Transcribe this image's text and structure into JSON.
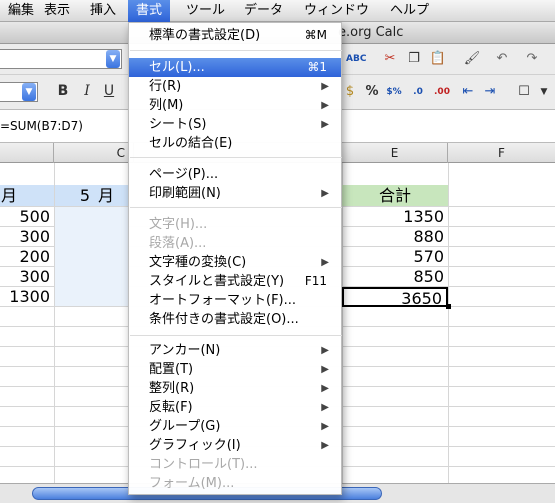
{
  "menubar": {
    "items": [
      {
        "label": "編集"
      },
      {
        "label": "表示"
      },
      {
        "label": "挿入"
      },
      {
        "label": "書式"
      },
      {
        "label": "ツール"
      },
      {
        "label": "データ"
      },
      {
        "label": "ウィンドウ"
      },
      {
        "label": "ヘルプ"
      }
    ]
  },
  "window": {
    "title": "e.org Calc"
  },
  "formula": {
    "text": "=SUM(B7:D7)"
  },
  "columns": {
    "c": "C",
    "e": "E",
    "f": "F"
  },
  "sheet": {
    "header_left": "月",
    "header_mid": "5月",
    "header_total": "合計",
    "col_a": [
      "500",
      "300",
      "200",
      "300",
      "1300"
    ],
    "col_e": [
      "1350",
      "880",
      "570",
      "850",
      "3650"
    ]
  },
  "menu": {
    "items": [
      {
        "label": "標準の書式設定(D)",
        "shortcut": "⌘M"
      },
      {
        "label": "セル(L)...",
        "shortcut": "⌘1"
      },
      {
        "label": "行(R)"
      },
      {
        "label": "列(M)"
      },
      {
        "label": "シート(S)"
      },
      {
        "label": "セルの結合(E)"
      },
      {
        "label": "ページ(P)..."
      },
      {
        "label": "印刷範囲(N)"
      },
      {
        "label": "文字(H)..."
      },
      {
        "label": "段落(A)..."
      },
      {
        "label": "文字種の変換(C)"
      },
      {
        "label": "スタイルと書式設定(Y)",
        "shortcut": "F11"
      },
      {
        "label": "オートフォーマット(F)..."
      },
      {
        "label": "条件付きの書式設定(O)..."
      },
      {
        "label": "アンカー(N)"
      },
      {
        "label": "配置(T)"
      },
      {
        "label": "整列(R)"
      },
      {
        "label": "反転(F)"
      },
      {
        "label": "グループ(G)"
      },
      {
        "label": "グラフィック(I)"
      },
      {
        "label": "コントロール(T)..."
      },
      {
        "label": "フォーム(M)..."
      }
    ]
  }
}
